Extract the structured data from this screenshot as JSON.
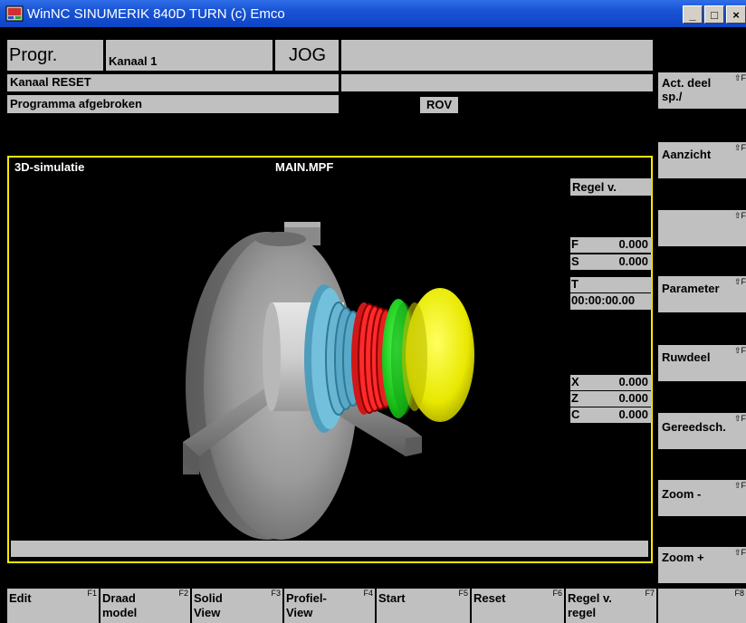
{
  "window": {
    "title": "WinNC SINUMERIK 840D TURN (c) Emco",
    "buttons": {
      "minimize": "_",
      "maximize": "□",
      "close": "×"
    }
  },
  "header": {
    "area": "Progr.",
    "channel": "Kanaal 1",
    "mode": "JOG",
    "channel_status": "Kanaal RESET",
    "program_status": "Programma afgebroken",
    "rov": "ROV"
  },
  "simulation": {
    "title": "3D-simulatie",
    "program": "MAIN.MPF",
    "block_label": "Regel v.",
    "feed": {
      "key": "F",
      "value": "0.000"
    },
    "spindle": {
      "key": "S",
      "value": "0.000"
    },
    "tool": {
      "key": "T",
      "value": ""
    },
    "time": "00:00:00.00",
    "axes": [
      {
        "key": "X",
        "value": "0.000"
      },
      {
        "key": "Z",
        "value": "0.000"
      },
      {
        "key": "C",
        "value": "0.000"
      }
    ],
    "colors": {
      "frame": "#ffea00",
      "chuck": "#9a9a9a",
      "thread_blue": "#5ab4d6",
      "thread_red": "#e81c1c",
      "collar_green": "#1ec81e",
      "dome_yellow": "#ecec00"
    }
  },
  "softkeys_right": [
    {
      "label": "Act. deel sp./",
      "fkey": "⇧F"
    },
    {
      "label": "Aanzicht",
      "fkey": "⇧F"
    },
    {
      "label": "",
      "fkey": "⇧F"
    },
    {
      "label": "Parameter",
      "fkey": "⇧F"
    },
    {
      "label": "Ruwdeel",
      "fkey": "⇧F"
    },
    {
      "label": "Gereedsch.",
      "fkey": "⇧F"
    },
    {
      "label": "Zoom -",
      "fkey": "⇧F"
    },
    {
      "label": "Zoom +",
      "fkey": "⇧F"
    }
  ],
  "softkeys_bottom": [
    {
      "label": "Edit",
      "fkey": "F1"
    },
    {
      "label": "Draad model",
      "fkey": "F2"
    },
    {
      "label": "Solid View",
      "fkey": "F3"
    },
    {
      "label": "Profiel- View",
      "fkey": "F4"
    },
    {
      "label": "Start",
      "fkey": "F5"
    },
    {
      "label": "Reset",
      "fkey": "F6"
    },
    {
      "label": "Regel v. regel",
      "fkey": "F7"
    },
    {
      "label": "",
      "fkey": "F8"
    }
  ]
}
